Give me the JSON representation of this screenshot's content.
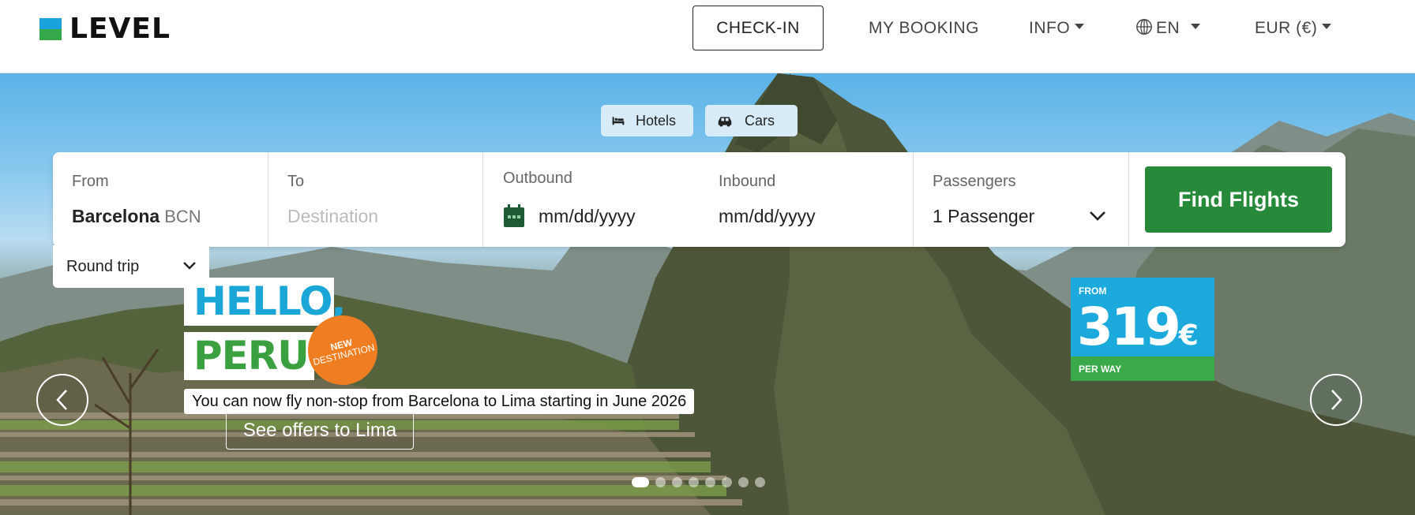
{
  "brand": {
    "name": "LEVEL",
    "colors": {
      "blue": "#1aa3dc",
      "green": "#35a84a"
    }
  },
  "nav": {
    "checkin": "CHECK-IN",
    "my_booking": "MY BOOKING",
    "info": "INFO",
    "language": "EN",
    "currency": "EUR (€)"
  },
  "extras": {
    "hotels": "Hotels",
    "cars": "Cars"
  },
  "search": {
    "from_label": "From",
    "from_city": "Barcelona",
    "from_code": "BCN",
    "to_label": "To",
    "to_placeholder": "Destination",
    "outbound_label": "Outbound",
    "outbound_value": "mm/dd/yyyy",
    "inbound_label": "Inbound",
    "inbound_value": "mm/dd/yyyy",
    "passengers_label": "Passengers",
    "passengers_value": "1 Passenger",
    "find_button": "Find Flights",
    "trip_type": "Round trip",
    "button_color": "#268a3a"
  },
  "banner": {
    "line1": "HELLO,",
    "line2": "PERU!",
    "badge_line1": "NEW",
    "badge_line2": "DESTINATION",
    "tagline": "You can now fly non-stop from Barcelona to Lima starting in June 2026",
    "cta": "See offers to Lima",
    "price_from": "FROM",
    "price_value": "319",
    "price_currency": "€",
    "price_per": "PER WAY"
  },
  "carousel": {
    "slide_count": 8,
    "active_slide": 1
  }
}
